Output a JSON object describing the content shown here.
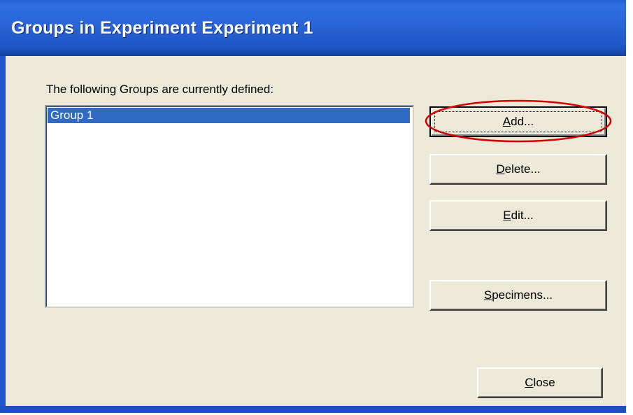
{
  "window": {
    "title": "Groups in Experiment Experiment 1"
  },
  "dialog": {
    "prompt": "The following Groups are currently defined:",
    "groups": [
      {
        "name": "Group 1",
        "selected": true
      }
    ]
  },
  "buttons": {
    "add": {
      "mnemonic": "A",
      "rest": "dd..."
    },
    "delete": {
      "mnemonic": "D",
      "rest": "elete..."
    },
    "edit": {
      "mnemonic": "E",
      "rest": "dit..."
    },
    "specimens": {
      "mnemonic": "S",
      "rest": "pecimens..."
    },
    "close": {
      "mnemonic": "C",
      "rest": "lose"
    }
  },
  "annotation": {
    "highlight_color": "#d40000",
    "highlighted_control": "add-button"
  },
  "colors": {
    "titlebar": "#2b66d8",
    "client_background": "#ece9d8",
    "selection": "#316ac5"
  }
}
